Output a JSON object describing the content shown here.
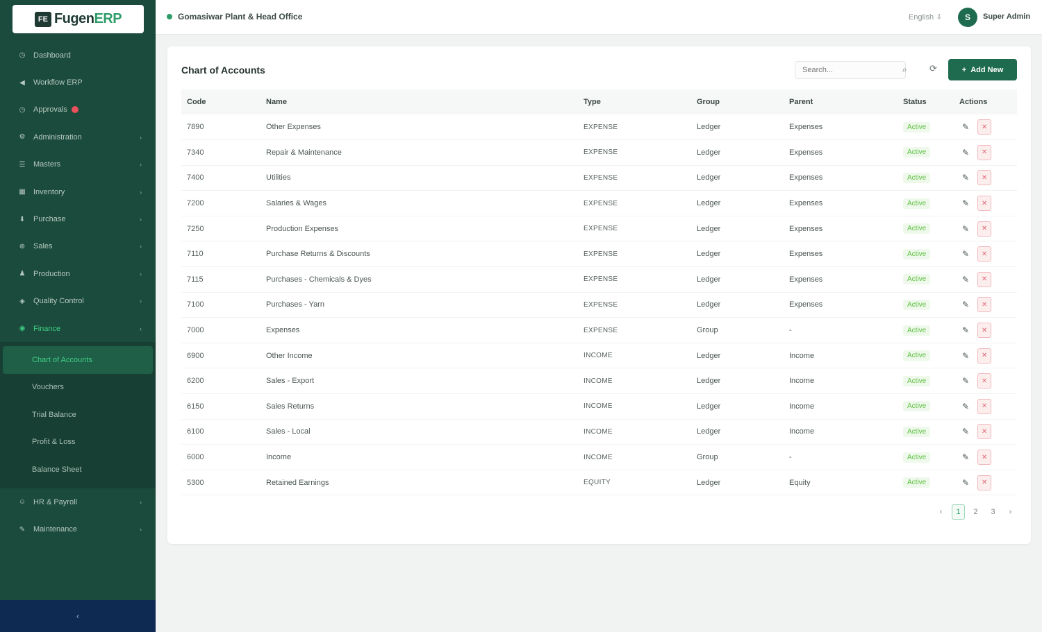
{
  "app": {
    "logo_main": "Fugen",
    "logo_accent": "ERP",
    "logo_mark": "FE"
  },
  "sidebar": {
    "items": [
      {
        "label": "Dashboard",
        "icon": "dashboard-icon",
        "glyph": "◷",
        "chevron": false
      },
      {
        "label": "Workflow ERP",
        "icon": "workflow-icon",
        "glyph": "◀",
        "chevron": false
      },
      {
        "label": "Approvals",
        "icon": "approvals-icon",
        "glyph": "◷",
        "chevron": false,
        "badge": true
      },
      {
        "label": "Administration",
        "icon": "gear-icon",
        "glyph": "⚙",
        "chevron": true
      },
      {
        "label": "Masters",
        "icon": "masters-icon",
        "glyph": "☰",
        "chevron": true
      },
      {
        "label": "Inventory",
        "icon": "inventory-icon",
        "glyph": "▦",
        "chevron": true
      },
      {
        "label": "Purchase",
        "icon": "purchase-icon",
        "glyph": "⬇",
        "chevron": true
      },
      {
        "label": "Sales",
        "icon": "sales-icon",
        "glyph": "⊕",
        "chevron": true
      },
      {
        "label": "Production",
        "icon": "production-icon",
        "glyph": "♟",
        "chevron": true
      },
      {
        "label": "Quality Control",
        "icon": "shield-icon",
        "glyph": "◈",
        "chevron": true
      },
      {
        "label": "Finance",
        "icon": "finance-icon",
        "glyph": "◉",
        "chevron": true,
        "active": true
      }
    ],
    "finance_sub": [
      {
        "label": "Chart of Accounts",
        "active": true
      },
      {
        "label": "Vouchers"
      },
      {
        "label": "Trial Balance"
      },
      {
        "label": "Profit & Loss"
      },
      {
        "label": "Balance Sheet"
      }
    ],
    "items_after": [
      {
        "label": "HR & Payroll",
        "icon": "hr-icon",
        "glyph": "☺",
        "chevron": true
      },
      {
        "label": "Maintenance",
        "icon": "wrench-icon",
        "glyph": "✎",
        "chevron": true
      }
    ],
    "collapse_glyph": "‹"
  },
  "header": {
    "org": "Gomasiwar Plant & Head Office",
    "language": "English ⇩",
    "avatar_initial": "S",
    "user": "Super Admin"
  },
  "card": {
    "title": "Chart of Accounts",
    "search_placeholder": "Search...",
    "add_label": "Add New",
    "columns": [
      "Code",
      "Name",
      "Type",
      "Group",
      "Parent",
      "Status",
      "Actions"
    ],
    "rows": [
      {
        "code": "7890",
        "name": "Other Expenses",
        "type": "EXPENSE",
        "group": "Ledger",
        "parent": "Expenses",
        "status": "Active"
      },
      {
        "code": "7340",
        "name": "Repair & Maintenance",
        "type": "EXPENSE",
        "group": "Ledger",
        "parent": "Expenses",
        "status": "Active"
      },
      {
        "code": "7400",
        "name": "Utilities",
        "type": "EXPENSE",
        "group": "Ledger",
        "parent": "Expenses",
        "status": "Active"
      },
      {
        "code": "7200",
        "name": "Salaries & Wages",
        "type": "EXPENSE",
        "group": "Ledger",
        "parent": "Expenses",
        "status": "Active"
      },
      {
        "code": "7250",
        "name": "Production Expenses",
        "type": "EXPENSE",
        "group": "Ledger",
        "parent": "Expenses",
        "status": "Active"
      },
      {
        "code": "7110",
        "name": "Purchase Returns & Discounts",
        "type": "EXPENSE",
        "group": "Ledger",
        "parent": "Expenses",
        "status": "Active"
      },
      {
        "code": "7115",
        "name": "Purchases - Chemicals & Dyes",
        "type": "EXPENSE",
        "group": "Ledger",
        "parent": "Expenses",
        "status": "Active"
      },
      {
        "code": "7100",
        "name": "Purchases - Yarn",
        "type": "EXPENSE",
        "group": "Ledger",
        "parent": "Expenses",
        "status": "Active"
      },
      {
        "code": "7000",
        "name": "Expenses",
        "type": "EXPENSE",
        "group": "Group",
        "parent": "-",
        "status": "Active"
      },
      {
        "code": "6900",
        "name": "Other Income",
        "type": "INCOME",
        "group": "Ledger",
        "parent": "Income",
        "status": "Active"
      },
      {
        "code": "6200",
        "name": "Sales - Export",
        "type": "INCOME",
        "group": "Ledger",
        "parent": "Income",
        "status": "Active"
      },
      {
        "code": "6150",
        "name": "Sales Returns",
        "type": "INCOME",
        "group": "Ledger",
        "parent": "Income",
        "status": "Active"
      },
      {
        "code": "6100",
        "name": "Sales - Local",
        "type": "INCOME",
        "group": "Ledger",
        "parent": "Income",
        "status": "Active"
      },
      {
        "code": "6000",
        "name": "Income",
        "type": "INCOME",
        "group": "Group",
        "parent": "-",
        "status": "Active"
      },
      {
        "code": "5300",
        "name": "Retained Earnings",
        "type": "EQUITY",
        "group": "Ledger",
        "parent": "Equity",
        "status": "Active"
      }
    ],
    "pagination": {
      "prev": "‹",
      "pages": [
        "1",
        "2",
        "3"
      ],
      "current": "1",
      "next": "›"
    }
  },
  "colors": {
    "sidebar": "#1b4b3c",
    "accent": "#1f6b50",
    "active_text": "#3fcf83",
    "status_green": "#5cbf3d",
    "delete_red": "#e06a76"
  }
}
